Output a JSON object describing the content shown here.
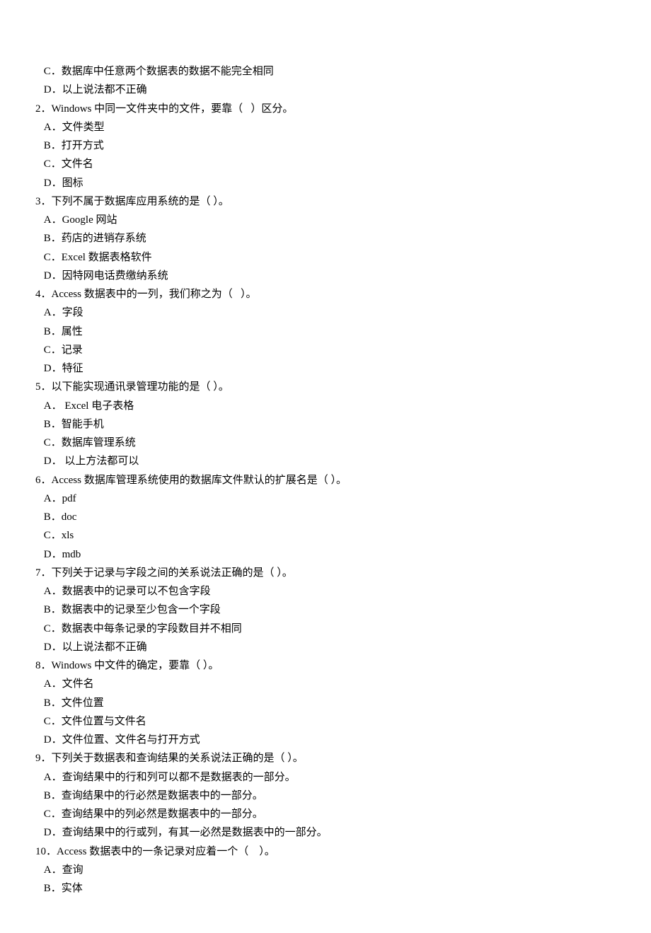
{
  "fragment_options": [
    " C．数据库中任意两个数据表的数据不能完全相同",
    " D．以上说法都不正确"
  ],
  "questions": [
    {
      "q": "2．Windows 中同一文件夹中的文件，要靠（   ）区分。",
      "opts": [
        " A．文件类型",
        " B．打开方式",
        " C．文件名",
        " D．图标"
      ]
    },
    {
      "q": "3．下列不属于数据库应用系统的是（ ）。",
      "opts": [
        " A．Google 网站",
        " B．药店的进销存系统",
        " C．Excel 数据表格软件",
        " D．因特网电话费缴纳系统"
      ]
    },
    {
      "q": "4．Access 数据表中的一列，我们称之为（   ）。",
      "opts": [
        " A．字段",
        " B．属性",
        " C．记录",
        " D．特征"
      ]
    },
    {
      "q": "5．以下能实现通讯录管理功能的是（ ）。",
      "opts": [
        " A． Excel 电子表格",
        " B．智能手机",
        " C．数据库管理系统",
        " D． 以上方法都可以"
      ]
    },
    {
      "q": "6．Access 数据库管理系统使用的数据库文件默认的扩展名是（ ）。",
      "opts": [
        " A．pdf",
        " B．doc",
        " C．xls",
        " D．mdb"
      ]
    },
    {
      "q": "7．下列关于记录与字段之间的关系说法正确的是（ ）。",
      "opts": [
        " A．数据表中的记录可以不包含字段",
        " B．数据表中的记录至少包含一个字段",
        " C．数据表中每条记录的字段数目并不相同",
        " D．以上说法都不正确"
      ]
    },
    {
      "q": "8．Windows 中文件的确定，要靠（ ）。",
      "opts": [
        " A．文件名",
        " B．文件位置",
        " C．文件位置与文件名",
        " D．文件位置、文件名与打开方式"
      ]
    },
    {
      "q": "9．下列关于数据表和查询结果的关系说法正确的是（ ）。",
      "opts": [
        " A．查询结果中的行和列可以都不是数据表的一部分。",
        " B．查询结果中的行必然是数据表中的一部分。",
        " C．查询结果中的列必然是数据表中的一部分。",
        " D．查询结果中的行或列，有其一必然是数据表中的一部分。"
      ]
    },
    {
      "q": "10．Access 数据表中的一条记录对应着一个（    ）。",
      "opts": [
        " A．查询",
        " B．实体"
      ]
    }
  ]
}
